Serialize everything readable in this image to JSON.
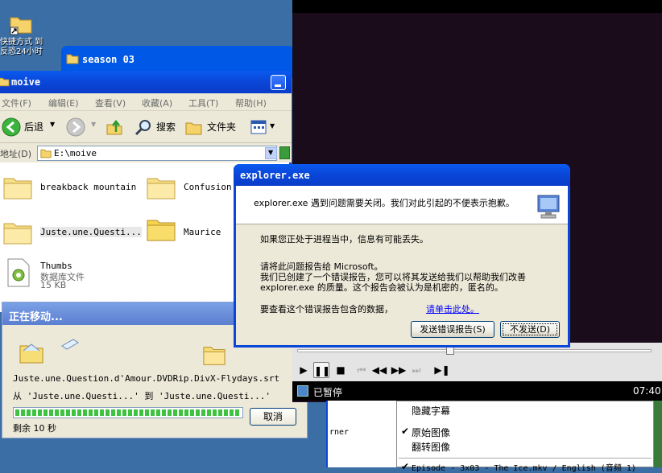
{
  "desktop": {
    "shortcut_label": "快捷方式 到 反恐24小时"
  },
  "season_window": {
    "title": "season 03"
  },
  "explorer": {
    "title": "moive",
    "menu": [
      "文件(F)",
      "编辑(E)",
      "查看(V)",
      "收藏(A)",
      "工具(T)",
      "帮助(H)"
    ],
    "toolbar": {
      "back_label": "后退",
      "search_label": "搜索",
      "folders_label": "文件夹"
    },
    "address": {
      "label": "地址(D)",
      "value": "E:\\moive"
    },
    "files": [
      {
        "name": "breakback mountain"
      },
      {
        "name": "Confusion."
      },
      {
        "name": "Juste.une.Questi..."
      },
      {
        "name": "Maurice"
      },
      {
        "name": "Thumbs",
        "type": "数据库文件",
        "size": "15 KB"
      }
    ]
  },
  "progress_dialog": {
    "title": "正在移动...",
    "filename": "Juste.une.Question.d'Amour.DVDRip.DivX-Flydays.srt",
    "from_to": "从 'Juste.une.Questi...' 到 'Juste.une.Questi...'",
    "progress": 1.0,
    "remaining": "剩余 10 秒",
    "cancel_label": "取消"
  },
  "error_dialog": {
    "title": "explorer.exe",
    "message": "explorer.exe 遇到问题需要关闭。我们对此引起的不便表示抱歉。",
    "info_loss": "如果您正处于进程当中，信息有可能丢失。",
    "report_line1": "请将此问题报告给 Microsoft。",
    "report_line2": "我们已创建了一个错误报告，您可以将其发送给我们以帮助我们改善 explorer.exe 的质量。这个报告会被认为是机密的，匿名的。",
    "view_data": "要查看这个错误报告包含的数据，",
    "link_label": "请单击此处。",
    "send_label": "发送错误报告(S)",
    "dont_send_label": "不发送(D)"
  },
  "player": {
    "status": "已暂停",
    "time": "07:40",
    "seek_position": 0.42
  },
  "context_menu": {
    "items": [
      {
        "label": "隐藏字幕",
        "checked": false
      },
      {
        "label": "原始图像",
        "checked": true
      },
      {
        "label": "翻转图像",
        "checked": false
      }
    ],
    "partial_item": "Episode - 3x03 - The Ice.mkv / English (音频 1)"
  },
  "behind_window": {
    "partial_text": "rner"
  },
  "colors": {
    "xp_blue": "#0a47d9",
    "progress_green": "#3fc23f",
    "desktop": "#3a6ea5"
  }
}
